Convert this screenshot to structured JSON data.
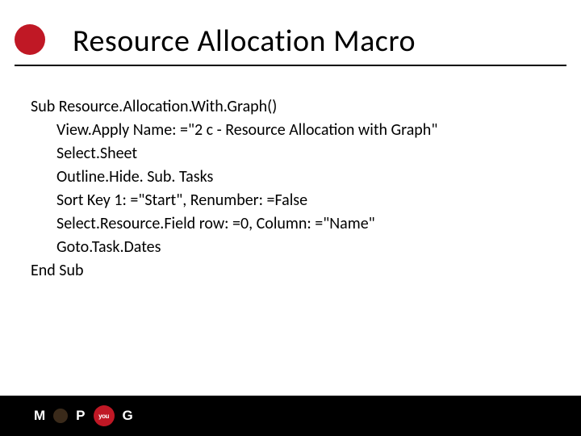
{
  "title": "Resource Allocation Macro",
  "code": {
    "line1": "Sub Resource.Allocation.With.Graph()",
    "line2": "View.Apply Name: =\"2 c - Resource Allocation with Graph\"",
    "line3": "Select.Sheet",
    "line4": "Outline.Hide. Sub. Tasks",
    "line5": "Sort Key 1: =\"Start\", Renumber: =False",
    "line6": "Select.Resource.Field row: =0, Column: =\"Name\"",
    "line7": "Goto.Task.Dates",
    "line8": "End Sub"
  },
  "logo": {
    "m": "M",
    "p": "P",
    "g": "G",
    "badge": "you"
  }
}
